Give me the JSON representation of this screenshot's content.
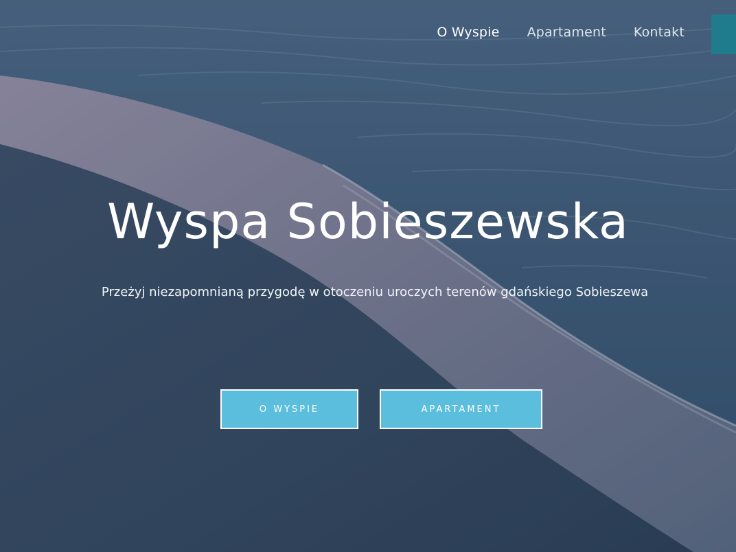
{
  "nav": {
    "items": [
      {
        "label": "O Wyspie"
      },
      {
        "label": "Apartament"
      },
      {
        "label": "Kontakt"
      }
    ]
  },
  "hero": {
    "title": "Wyspa Sobieszewska",
    "subtitle": "Przeżyj niezapomnianą przygodę w otoczeniu uroczych terenów gdańskiego Sobieszewa",
    "buttons": [
      {
        "label": "O WYSPIE"
      },
      {
        "label": "APARTAMENT"
      }
    ]
  },
  "colors": {
    "button_bg": "#5bbedd",
    "menu_toggle": "#1f7c8c",
    "sea": "#3e5570",
    "sand": "#8d8aa0"
  },
  "icons": {
    "menu_toggle": "menu-toggle-icon"
  }
}
